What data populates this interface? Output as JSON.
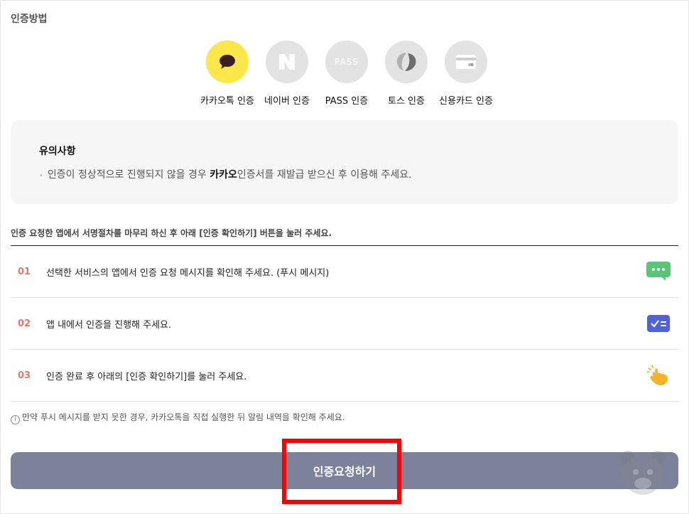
{
  "section_title": "인증방법",
  "methods": [
    {
      "label": "카카오톡 인증",
      "icon": "kakao-chat-icon",
      "active": true
    },
    {
      "label": "네이버 인증",
      "icon": "naver-n-icon",
      "active": false
    },
    {
      "label": "PASS 인증",
      "icon": "pass-icon",
      "icon_text": "PASS",
      "active": false
    },
    {
      "label": "토스 인증",
      "icon": "toss-icon",
      "active": false
    },
    {
      "label": "신용카드 인증",
      "icon": "credit-card-icon",
      "active": false
    }
  ],
  "notice": {
    "title": "유의사항",
    "text_before": "인증이 정상적으로 진행되지 않을 경우 ",
    "text_bold": "카카오",
    "text_after": "인증서를 재발급 받으신 후 이용해 주세요."
  },
  "guide": "인증 요청한 앱에서 서명절차를 마무리 하신 후 아래 [인증 확인하기] 버튼을 눌러 주세요.",
  "steps": [
    {
      "num": "01",
      "text": "선택한 서비스의 앱에서 인증 요청 메시지를 확인해 주세요. (푸시 메시지)",
      "icon": "chat-bubble-icon"
    },
    {
      "num": "02",
      "text": "앱 내에서 인증을 진행해 주세요.",
      "icon": "checklist-icon"
    },
    {
      "num": "03",
      "text": "인증 완료 후 아래의 [인증 확인하기]를 눌러 주세요.",
      "icon": "tap-hand-icon"
    }
  ],
  "info_icon": "i",
  "info": "만약 푸시 메시지를 받지 못한 경우, 카카오톡을 직접 실행한 뒤 알림 내역을 확인해 주세요.",
  "button_label": "인증요청하기",
  "colors": {
    "kakao_yellow": "#fae84a",
    "step_number": "#e2776b",
    "button_bg": "#7c8299",
    "highlight": "#ff0000"
  }
}
